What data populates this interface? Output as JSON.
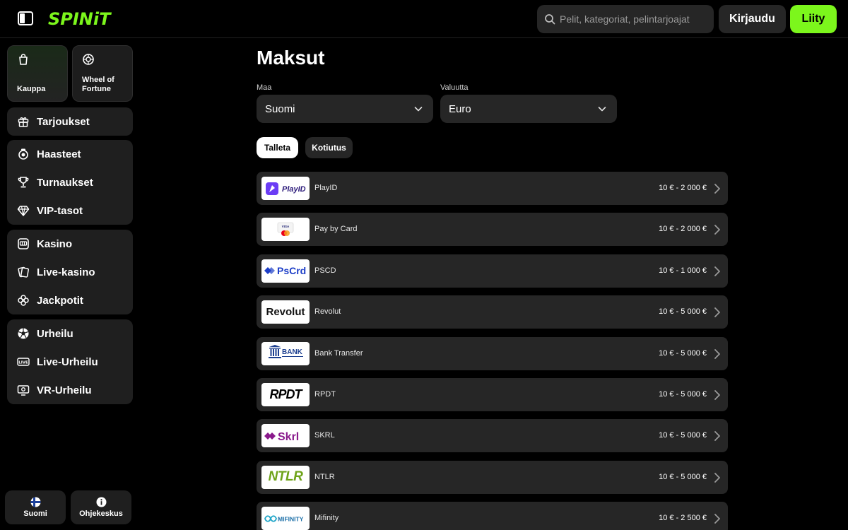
{
  "header": {
    "logo": "SPINiT",
    "search_placeholder": "Pelit, kategoriat, pelintarjoajat",
    "login_label": "Kirjaudu",
    "join_label": "Liity",
    "accent": "#7cf61c"
  },
  "sidebar": {
    "tiles": [
      {
        "label": "Kauppa",
        "icon": "shopping-bag-icon"
      },
      {
        "label": "Wheel of Fortune",
        "icon": "wheel-icon"
      }
    ],
    "groups": [
      [
        {
          "label": "Tarjoukset",
          "icon": "gift-icon"
        }
      ],
      [
        {
          "label": "Haasteet",
          "icon": "challenge-icon"
        },
        {
          "label": "Turnaukset",
          "icon": "trophy-icon"
        },
        {
          "label": "VIP-tasot",
          "icon": "diamond-icon"
        }
      ],
      [
        {
          "label": "Kasino",
          "icon": "slot-machine-icon"
        },
        {
          "label": "Live-kasino",
          "icon": "cards-icon"
        },
        {
          "label": "Jackpotit",
          "icon": "clover-icon"
        }
      ],
      [
        {
          "label": "Urheilu",
          "icon": "football-icon"
        },
        {
          "label": "Live-Urheilu",
          "icon": "live-icon"
        },
        {
          "label": "VR-Urheilu",
          "icon": "vr-screen-icon"
        }
      ]
    ],
    "bottom": [
      {
        "label": "Suomi",
        "icon": "finland-flag-icon"
      },
      {
        "label": "Ohjekeskus",
        "icon": "info-icon"
      }
    ]
  },
  "main": {
    "title": "Maksut",
    "country_label": "Maa",
    "country_value": "Suomi",
    "currency_label": "Valuutta",
    "currency_value": "Euro",
    "tabs": [
      {
        "label": "Talleta",
        "active": true
      },
      {
        "label": "Kotiutus",
        "active": false
      }
    ],
    "methods": [
      {
        "name": "PlayID",
        "range": "10 € - 2 000 €",
        "logo": "PlayID"
      },
      {
        "name": "Pay by Card",
        "range": "10 € - 2 000 €",
        "logo": "VISA"
      },
      {
        "name": "PSCD",
        "range": "10 € - 1 000 €",
        "logo": "PsCrd"
      },
      {
        "name": "Revolut",
        "range": "10 € - 5 000 €",
        "logo": "Revolut"
      },
      {
        "name": "Bank Transfer",
        "range": "10 € - 5 000 €",
        "logo": "BANK"
      },
      {
        "name": "RPDT",
        "range": "10 € - 5 000 €",
        "logo": "RPDT"
      },
      {
        "name": "SKRL",
        "range": "10 € - 5 000 €",
        "logo": "Skrl"
      },
      {
        "name": "NTLR",
        "range": "10 € - 5 000 €",
        "logo": "NTLR"
      },
      {
        "name": "Mifinity",
        "range": "10 € - 2 500 €",
        "logo": "MIFINITY"
      }
    ]
  }
}
